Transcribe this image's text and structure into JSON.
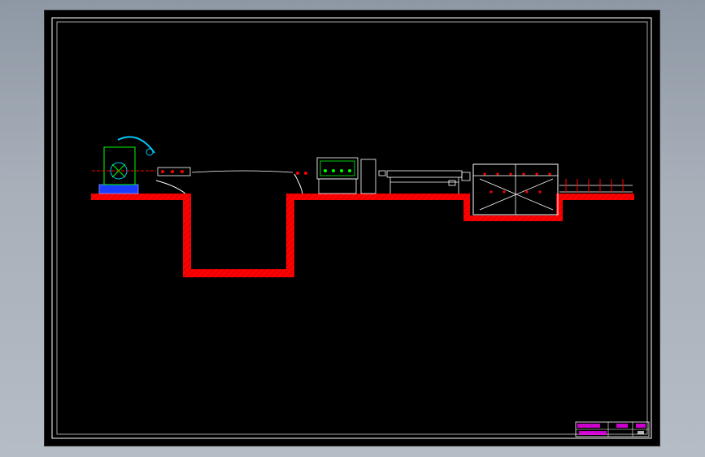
{
  "drawing": {
    "background_color": "#000000",
    "viewport_color": "#9aa3ae",
    "frame_color": "#ffffff",
    "section_fill_color": "#ff0000",
    "equipment_color": "#ffffff",
    "accent_green": "#00ff00",
    "accent_cyan": "#00c8ff",
    "accent_magenta": "#ff00ff"
  },
  "components": [
    {
      "name": "uncoiler",
      "icon": "uncoiler-icon"
    },
    {
      "name": "pinch-roll-1",
      "icon": "roller-icon"
    },
    {
      "name": "looper-pit",
      "icon": "pit-icon"
    },
    {
      "name": "pinch-roll-2",
      "icon": "roller-icon"
    },
    {
      "name": "leveler",
      "icon": "leveler-icon"
    },
    {
      "name": "shear",
      "icon": "shear-icon"
    },
    {
      "name": "conveyor-table",
      "icon": "conveyor-icon"
    },
    {
      "name": "stacker-pit",
      "icon": "stacker-icon"
    },
    {
      "name": "roller-table",
      "icon": "roller-table-icon"
    }
  ]
}
